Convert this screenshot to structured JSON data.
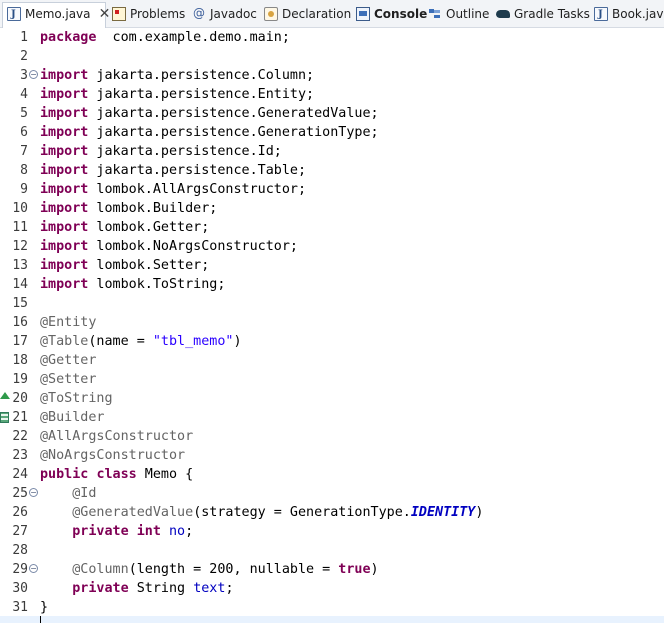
{
  "tabs": [
    {
      "label": "Memo.java",
      "icon": "java-file-icon",
      "active": true,
      "close": "✕"
    },
    {
      "label": "Problems",
      "icon": "problems-icon"
    },
    {
      "label": "Javadoc",
      "icon": "javadoc-icon"
    },
    {
      "label": "Declaration",
      "icon": "declaration-icon"
    },
    {
      "label": "Console",
      "icon": "console-icon"
    },
    {
      "label": "Outline",
      "icon": "outline-icon"
    },
    {
      "label": "Gradle Tasks",
      "icon": "gradle-icon"
    },
    {
      "label": "Book.java",
      "icon": "java-file-icon"
    }
  ],
  "editor": {
    "lines": [
      {
        "n": "1",
        "tokens": [
          [
            "kw",
            "package"
          ],
          [
            "",
            "  com.example.demo.main;"
          ]
        ]
      },
      {
        "n": "2",
        "tokens": []
      },
      {
        "n": "3",
        "fold": "−",
        "tokens": [
          [
            "kw",
            "import"
          ],
          [
            "",
            " jakarta.persistence.Column;"
          ]
        ]
      },
      {
        "n": "4",
        "tokens": [
          [
            "kw",
            "import"
          ],
          [
            "",
            " jakarta.persistence.Entity;"
          ]
        ]
      },
      {
        "n": "5",
        "tokens": [
          [
            "kw",
            "import"
          ],
          [
            "",
            " jakarta.persistence.GeneratedValue;"
          ]
        ]
      },
      {
        "n": "6",
        "tokens": [
          [
            "kw",
            "import"
          ],
          [
            "",
            " jakarta.persistence.GenerationType;"
          ]
        ]
      },
      {
        "n": "7",
        "tokens": [
          [
            "kw",
            "import"
          ],
          [
            "",
            " jakarta.persistence.Id;"
          ]
        ]
      },
      {
        "n": "8",
        "tokens": [
          [
            "kw",
            "import"
          ],
          [
            "",
            " jakarta.persistence.Table;"
          ]
        ]
      },
      {
        "n": "9",
        "tokens": [
          [
            "kw",
            "import"
          ],
          [
            "",
            " lombok.AllArgsConstructor;"
          ]
        ]
      },
      {
        "n": "10",
        "tokens": [
          [
            "kw",
            "import"
          ],
          [
            "",
            " lombok.Builder;"
          ]
        ]
      },
      {
        "n": "11",
        "tokens": [
          [
            "kw",
            "import"
          ],
          [
            "",
            " lombok.Getter;"
          ]
        ]
      },
      {
        "n": "12",
        "tokens": [
          [
            "kw",
            "import"
          ],
          [
            "",
            " lombok.NoArgsConstructor;"
          ]
        ]
      },
      {
        "n": "13",
        "tokens": [
          [
            "kw",
            "import"
          ],
          [
            "",
            " lombok.Setter;"
          ]
        ]
      },
      {
        "n": "14",
        "tokens": [
          [
            "kw",
            "import"
          ],
          [
            "",
            " lombok.ToString;"
          ]
        ]
      },
      {
        "n": "15",
        "tokens": []
      },
      {
        "n": "16",
        "tokens": [
          [
            "ann",
            "@Entity"
          ]
        ]
      },
      {
        "n": "17",
        "tokens": [
          [
            "ann",
            "@Table"
          ],
          [
            "",
            "(name = "
          ],
          [
            "str",
            "\"tbl_memo\""
          ],
          [
            "",
            ")"
          ]
        ]
      },
      {
        "n": "18",
        "tokens": [
          [
            "ann",
            "@Getter"
          ]
        ]
      },
      {
        "n": "19",
        "tokens": [
          [
            "ann",
            "@Setter"
          ]
        ]
      },
      {
        "n": "20",
        "marker": "up",
        "tokens": [
          [
            "ann",
            "@ToString"
          ]
        ]
      },
      {
        "n": "21",
        "marker": "box",
        "tokens": [
          [
            "ann",
            "@Builder"
          ]
        ]
      },
      {
        "n": "22",
        "tokens": [
          [
            "ann",
            "@AllArgsConstructor"
          ]
        ]
      },
      {
        "n": "23",
        "tokens": [
          [
            "ann",
            "@NoArgsConstructor"
          ]
        ]
      },
      {
        "n": "24",
        "tokens": [
          [
            "kw",
            "public"
          ],
          [
            "",
            " "
          ],
          [
            "kw",
            "class"
          ],
          [
            "",
            " Memo {"
          ]
        ]
      },
      {
        "n": "25",
        "fold": "−",
        "tokens": [
          [
            "",
            "    "
          ],
          [
            "ann",
            "@Id"
          ]
        ]
      },
      {
        "n": "26",
        "tokens": [
          [
            "",
            "    "
          ],
          [
            "ann",
            "@GeneratedValue"
          ],
          [
            "",
            "(strategy = GenerationType."
          ],
          [
            "const",
            "IDENTITY"
          ],
          [
            "",
            ")"
          ]
        ]
      },
      {
        "n": "27",
        "tokens": [
          [
            "",
            "    "
          ],
          [
            "kw",
            "private"
          ],
          [
            "",
            " "
          ],
          [
            "kw",
            "int"
          ],
          [
            "",
            " "
          ],
          [
            "fld",
            "no"
          ],
          [
            "",
            ";"
          ]
        ]
      },
      {
        "n": "28",
        "tokens": []
      },
      {
        "n": "29",
        "fold": "−",
        "tokens": [
          [
            "",
            "    "
          ],
          [
            "ann",
            "@Column"
          ],
          [
            "",
            "(length = 200, nullable = "
          ],
          [
            "kw",
            "true"
          ],
          [
            "",
            ")"
          ]
        ]
      },
      {
        "n": "30",
        "tokens": [
          [
            "",
            "    "
          ],
          [
            "kw",
            "private"
          ],
          [
            "",
            " String "
          ],
          [
            "fld",
            "text"
          ],
          [
            "",
            ";"
          ]
        ]
      },
      {
        "n": "31",
        "tokens": [
          [
            "",
            "}"
          ]
        ]
      }
    ]
  },
  "colors": {
    "keyword": "#7f0055",
    "annotation": "#646464",
    "string": "#2a00ff",
    "field": "#0000c0"
  }
}
